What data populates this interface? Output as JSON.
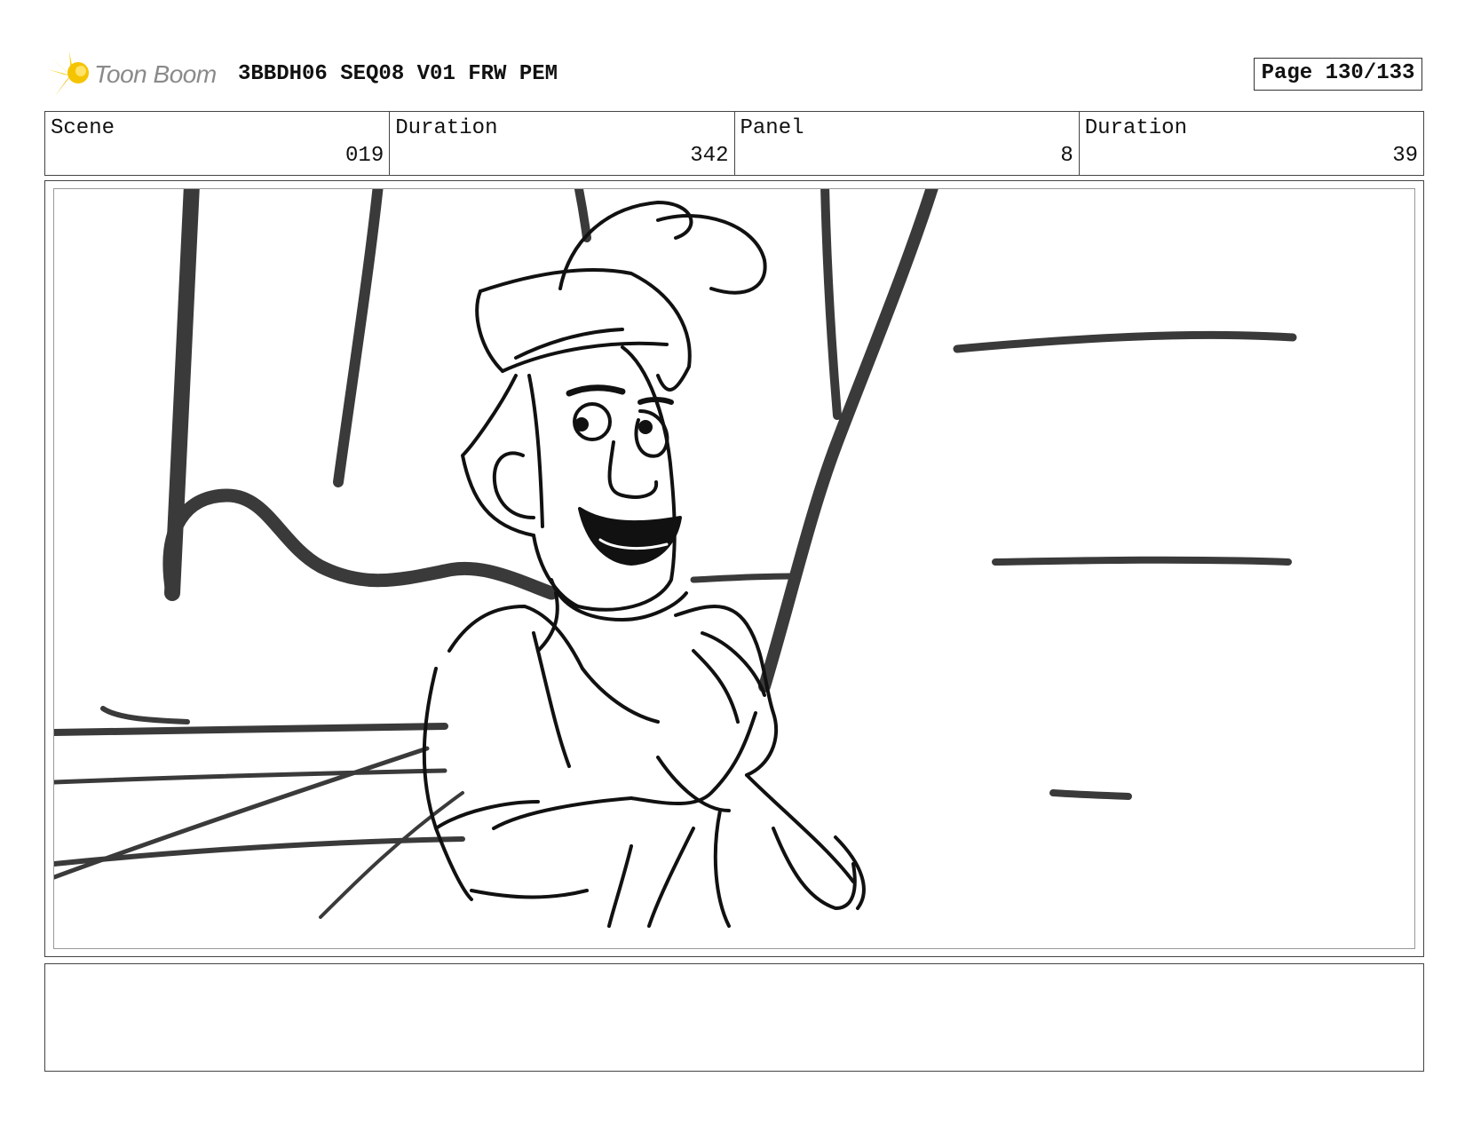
{
  "header": {
    "logo_text": "Toon Boom",
    "document_title": "3BBDH06 SEQ08 V01 FRW PEM",
    "page_label": "Page 130/133"
  },
  "info": {
    "scene_label": "Scene",
    "scene_value": "019",
    "scene_duration_label": "Duration",
    "scene_duration_value": "342",
    "panel_label": "Panel",
    "panel_value": "8",
    "panel_duration_label": "Duration",
    "panel_duration_value": "39"
  },
  "panel_image": {
    "icon": "storyboard-sketch-smiling-character-clasped-hands"
  },
  "notes": {
    "text": ""
  }
}
